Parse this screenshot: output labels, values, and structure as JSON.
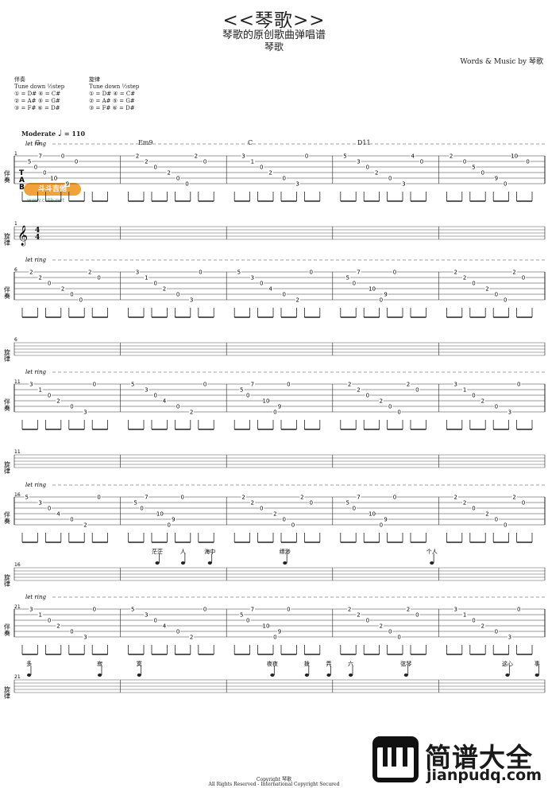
{
  "header": {
    "title": "<<琴歌>>",
    "subtitle": "琴歌的原创歌曲弹唱谱",
    "artist": "琴歌",
    "credits": "Words & Music by 琴歌"
  },
  "tuning": {
    "accomp": {
      "label": "伴奏",
      "tune": "Tune down ½step",
      "l1": "① = D#  ④ = C#",
      "l2": "② = A#  ⑤ = G#",
      "l3": "③ = F#  ⑥ = D#"
    },
    "melody": {
      "label": "旋律",
      "tune": "Tune down ½step",
      "l1": "① = D#  ④ = C#",
      "l2": "② = A#  ⑤ = G#",
      "l3": "③ = F#  ⑥ = D#"
    }
  },
  "tempo": {
    "label": "Moderate",
    "value": "= 110"
  },
  "let_ring": "let ring",
  "track_labels": {
    "accomp": "伴奏",
    "melody": "旋律"
  },
  "time_sig": [
    "4",
    "4"
  ],
  "chords": [
    "G",
    "Em9",
    "C",
    "D11"
  ],
  "logo": {
    "name": "斗斗吉他",
    "url": "www.cctb.net"
  },
  "footer": {
    "line1": "Copyright  琴歌",
    "line2": "All Rights Reserved - International Copyright Secured"
  },
  "watermark": {
    "line1": "简谱大全",
    "line2": "jianpudq.com"
  },
  "systems": [
    {
      "num": "1",
      "tab": [
        [
          [
            "7",
            0.2
          ],
          [
            "5",
            0.08
          ],
          [
            "0",
            0.15
          ],
          [
            "0",
            0.25
          ],
          [
            "10",
            0.35
          ],
          [
            "9",
            0.5
          ],
          [
            "0",
            0.45
          ],
          [
            "0",
            0.6
          ]
        ],
        [
          [
            "2",
            0.1
          ],
          [
            "2",
            0.2
          ],
          [
            "0",
            0.3
          ],
          [
            "2",
            0.45
          ],
          [
            "0",
            0.55
          ],
          [
            "0",
            0.65
          ],
          [
            "2",
            0.75
          ],
          [
            "0",
            0.85
          ]
        ],
        [
          [
            "3",
            0.1
          ],
          [
            "1",
            0.2
          ],
          [
            "0",
            0.3
          ],
          [
            "2",
            0.4
          ],
          [
            "0",
            0.55
          ],
          [
            "3",
            0.7
          ],
          [
            "0",
            0.8
          ]
        ],
        [
          [
            "5",
            0.05
          ],
          [
            "3",
            0.2
          ],
          [
            "0",
            0.3
          ],
          [
            "2",
            0.4
          ],
          [
            "0",
            0.55
          ],
          [
            "3",
            0.7
          ],
          [
            "4",
            0.8
          ],
          [
            "0",
            0.9
          ]
        ],
        [
          [
            "2",
            0.05
          ],
          [
            "0",
            0.2
          ],
          [
            "5",
            0.3
          ],
          [
            "0",
            0.4
          ],
          [
            "9",
            0.55
          ],
          [
            "0",
            0.65
          ],
          [
            "10",
            0.75
          ],
          [
            "0",
            0.9
          ]
        ]
      ],
      "lyrics": [],
      "melody": false
    },
    {
      "num": "6",
      "tab": [
        [
          [
            "2",
            0.1
          ],
          [
            "2",
            0.2
          ],
          [
            "0",
            0.3
          ],
          [
            "2",
            0.45
          ],
          [
            "0",
            0.55
          ],
          [
            "0",
            0.65
          ],
          [
            "2",
            0.75
          ],
          [
            "0",
            0.85
          ]
        ],
        [
          [
            "3",
            0.1
          ],
          [
            "1",
            0.2
          ],
          [
            "0",
            0.3
          ],
          [
            "2",
            0.4
          ],
          [
            "0",
            0.55
          ],
          [
            "3",
            0.7
          ],
          [
            "0",
            0.8
          ]
        ],
        [
          [
            "5",
            0.05
          ],
          [
            "3",
            0.2
          ],
          [
            "0",
            0.3
          ],
          [
            "4",
            0.4
          ],
          [
            "0",
            0.55
          ],
          [
            "2",
            0.7
          ],
          [
            "0",
            0.85
          ]
        ],
        [
          [
            "7",
            0.2
          ],
          [
            "5",
            0.08
          ],
          [
            "0",
            0.15
          ],
          [
            "10",
            0.35
          ],
          [
            "9",
            0.5
          ],
          [
            "0",
            0.45
          ],
          [
            "0",
            0.6
          ]
        ],
        [
          [
            "2",
            0.1
          ],
          [
            "2",
            0.2
          ],
          [
            "0",
            0.3
          ],
          [
            "2",
            0.45
          ],
          [
            "0",
            0.55
          ],
          [
            "0",
            0.65
          ],
          [
            "2",
            0.75
          ],
          [
            "0",
            0.85
          ]
        ]
      ],
      "lyrics": [],
      "melody": false
    },
    {
      "num": "11",
      "tab": [
        [
          [
            "3",
            0.1
          ],
          [
            "1",
            0.2
          ],
          [
            "0",
            0.3
          ],
          [
            "2",
            0.4
          ],
          [
            "0",
            0.55
          ],
          [
            "3",
            0.7
          ],
          [
            "0",
            0.8
          ]
        ],
        [
          [
            "5",
            0.05
          ],
          [
            "3",
            0.2
          ],
          [
            "0",
            0.3
          ],
          [
            "4",
            0.4
          ],
          [
            "0",
            0.55
          ],
          [
            "2",
            0.7
          ],
          [
            "0",
            0.85
          ]
        ],
        [
          [
            "7",
            0.2
          ],
          [
            "5",
            0.08
          ],
          [
            "0",
            0.15
          ],
          [
            "10",
            0.35
          ],
          [
            "9",
            0.5
          ],
          [
            "0",
            0.45
          ],
          [
            "0",
            0.6
          ]
        ],
        [
          [
            "2",
            0.1
          ],
          [
            "2",
            0.2
          ],
          [
            "0",
            0.3
          ],
          [
            "2",
            0.45
          ],
          [
            "0",
            0.55
          ],
          [
            "0",
            0.65
          ],
          [
            "2",
            0.75
          ],
          [
            "0",
            0.85
          ]
        ],
        [
          [
            "3",
            0.1
          ],
          [
            "1",
            0.2
          ],
          [
            "0",
            0.3
          ],
          [
            "2",
            0.4
          ],
          [
            "0",
            0.55
          ],
          [
            "3",
            0.7
          ],
          [
            "0",
            0.8
          ]
        ]
      ],
      "lyrics": [],
      "melody": false
    },
    {
      "num": "16",
      "tab": [
        [
          [
            "5",
            0.05
          ],
          [
            "3",
            0.2
          ],
          [
            "0",
            0.3
          ],
          [
            "4",
            0.4
          ],
          [
            "0",
            0.55
          ],
          [
            "2",
            0.7
          ],
          [
            "0",
            0.85
          ]
        ],
        [
          [
            "7",
            0.2
          ],
          [
            "5",
            0.08
          ],
          [
            "0",
            0.15
          ],
          [
            "10",
            0.35
          ],
          [
            "9",
            0.5
          ],
          [
            "0",
            0.45
          ],
          [
            "0",
            0.6
          ]
        ],
        [
          [
            "2",
            0.1
          ],
          [
            "2",
            0.2
          ],
          [
            "0",
            0.3
          ],
          [
            "2",
            0.45
          ],
          [
            "0",
            0.55
          ],
          [
            "0",
            0.65
          ],
          [
            "2",
            0.75
          ],
          [
            "0",
            0.85
          ]
        ],
        [
          [
            "7",
            0.2
          ],
          [
            "5",
            0.08
          ],
          [
            "0",
            0.15
          ],
          [
            "10",
            0.35
          ],
          [
            "9",
            0.5
          ],
          [
            "0",
            0.45
          ],
          [
            "0",
            0.6
          ]
        ],
        [
          [
            "2",
            0.1
          ],
          [
            "2",
            0.2
          ],
          [
            "0",
            0.3
          ],
          [
            "2",
            0.45
          ],
          [
            "0",
            0.55
          ],
          [
            "0",
            0.65
          ],
          [
            "2",
            0.75
          ],
          [
            "0",
            0.85
          ]
        ]
      ],
      "lyrics": [
        [
          "茫茫",
          0.287
        ],
        [
          "人",
          0.334
        ],
        [
          "海中",
          0.383
        ],
        [
          "缥渺",
          0.52
        ],
        [
          "个人",
          0.788
        ]
      ],
      "melody": true
    },
    {
      "num": "21",
      "tab": [
        [
          [
            "3",
            0.1
          ],
          [
            "1",
            0.2
          ],
          [
            "0",
            0.3
          ],
          [
            "2",
            0.4
          ],
          [
            "0",
            0.55
          ],
          [
            "3",
            0.7
          ],
          [
            "0",
            0.8
          ]
        ],
        [
          [
            "5",
            0.05
          ],
          [
            "3",
            0.2
          ],
          [
            "0",
            0.3
          ],
          [
            "4",
            0.4
          ],
          [
            "0",
            0.55
          ],
          [
            "2",
            0.7
          ],
          [
            "0",
            0.85
          ]
        ],
        [
          [
            "7",
            0.2
          ],
          [
            "5",
            0.08
          ],
          [
            "0",
            0.15
          ],
          [
            "10",
            0.35
          ],
          [
            "9",
            0.5
          ],
          [
            "0",
            0.45
          ],
          [
            "0",
            0.6
          ]
        ],
        [
          [
            "2",
            0.1
          ],
          [
            "2",
            0.2
          ],
          [
            "0",
            0.3
          ],
          [
            "2",
            0.45
          ],
          [
            "0",
            0.55
          ],
          [
            "0",
            0.65
          ],
          [
            "2",
            0.75
          ],
          [
            "0",
            0.85
          ]
        ],
        [
          [
            "3",
            0.1
          ],
          [
            "1",
            0.2
          ],
          [
            "0",
            0.3
          ],
          [
            "2",
            0.4
          ],
          [
            "0",
            0.55
          ],
          [
            "3",
            0.7
          ],
          [
            "0",
            0.8
          ]
        ]
      ],
      "lyrics": [
        [
          "多",
          0.053
        ],
        [
          "寂",
          0.182
        ],
        [
          "寞",
          0.254
        ],
        [
          "夜夜",
          0.497
        ],
        [
          "拨",
          0.56
        ],
        [
          "弄",
          0.6
        ],
        [
          "六",
          0.64
        ],
        [
          "弦琴",
          0.741
        ],
        [
          "这心",
          0.926
        ],
        [
          "事",
          0.98
        ]
      ],
      "melody": true
    }
  ]
}
